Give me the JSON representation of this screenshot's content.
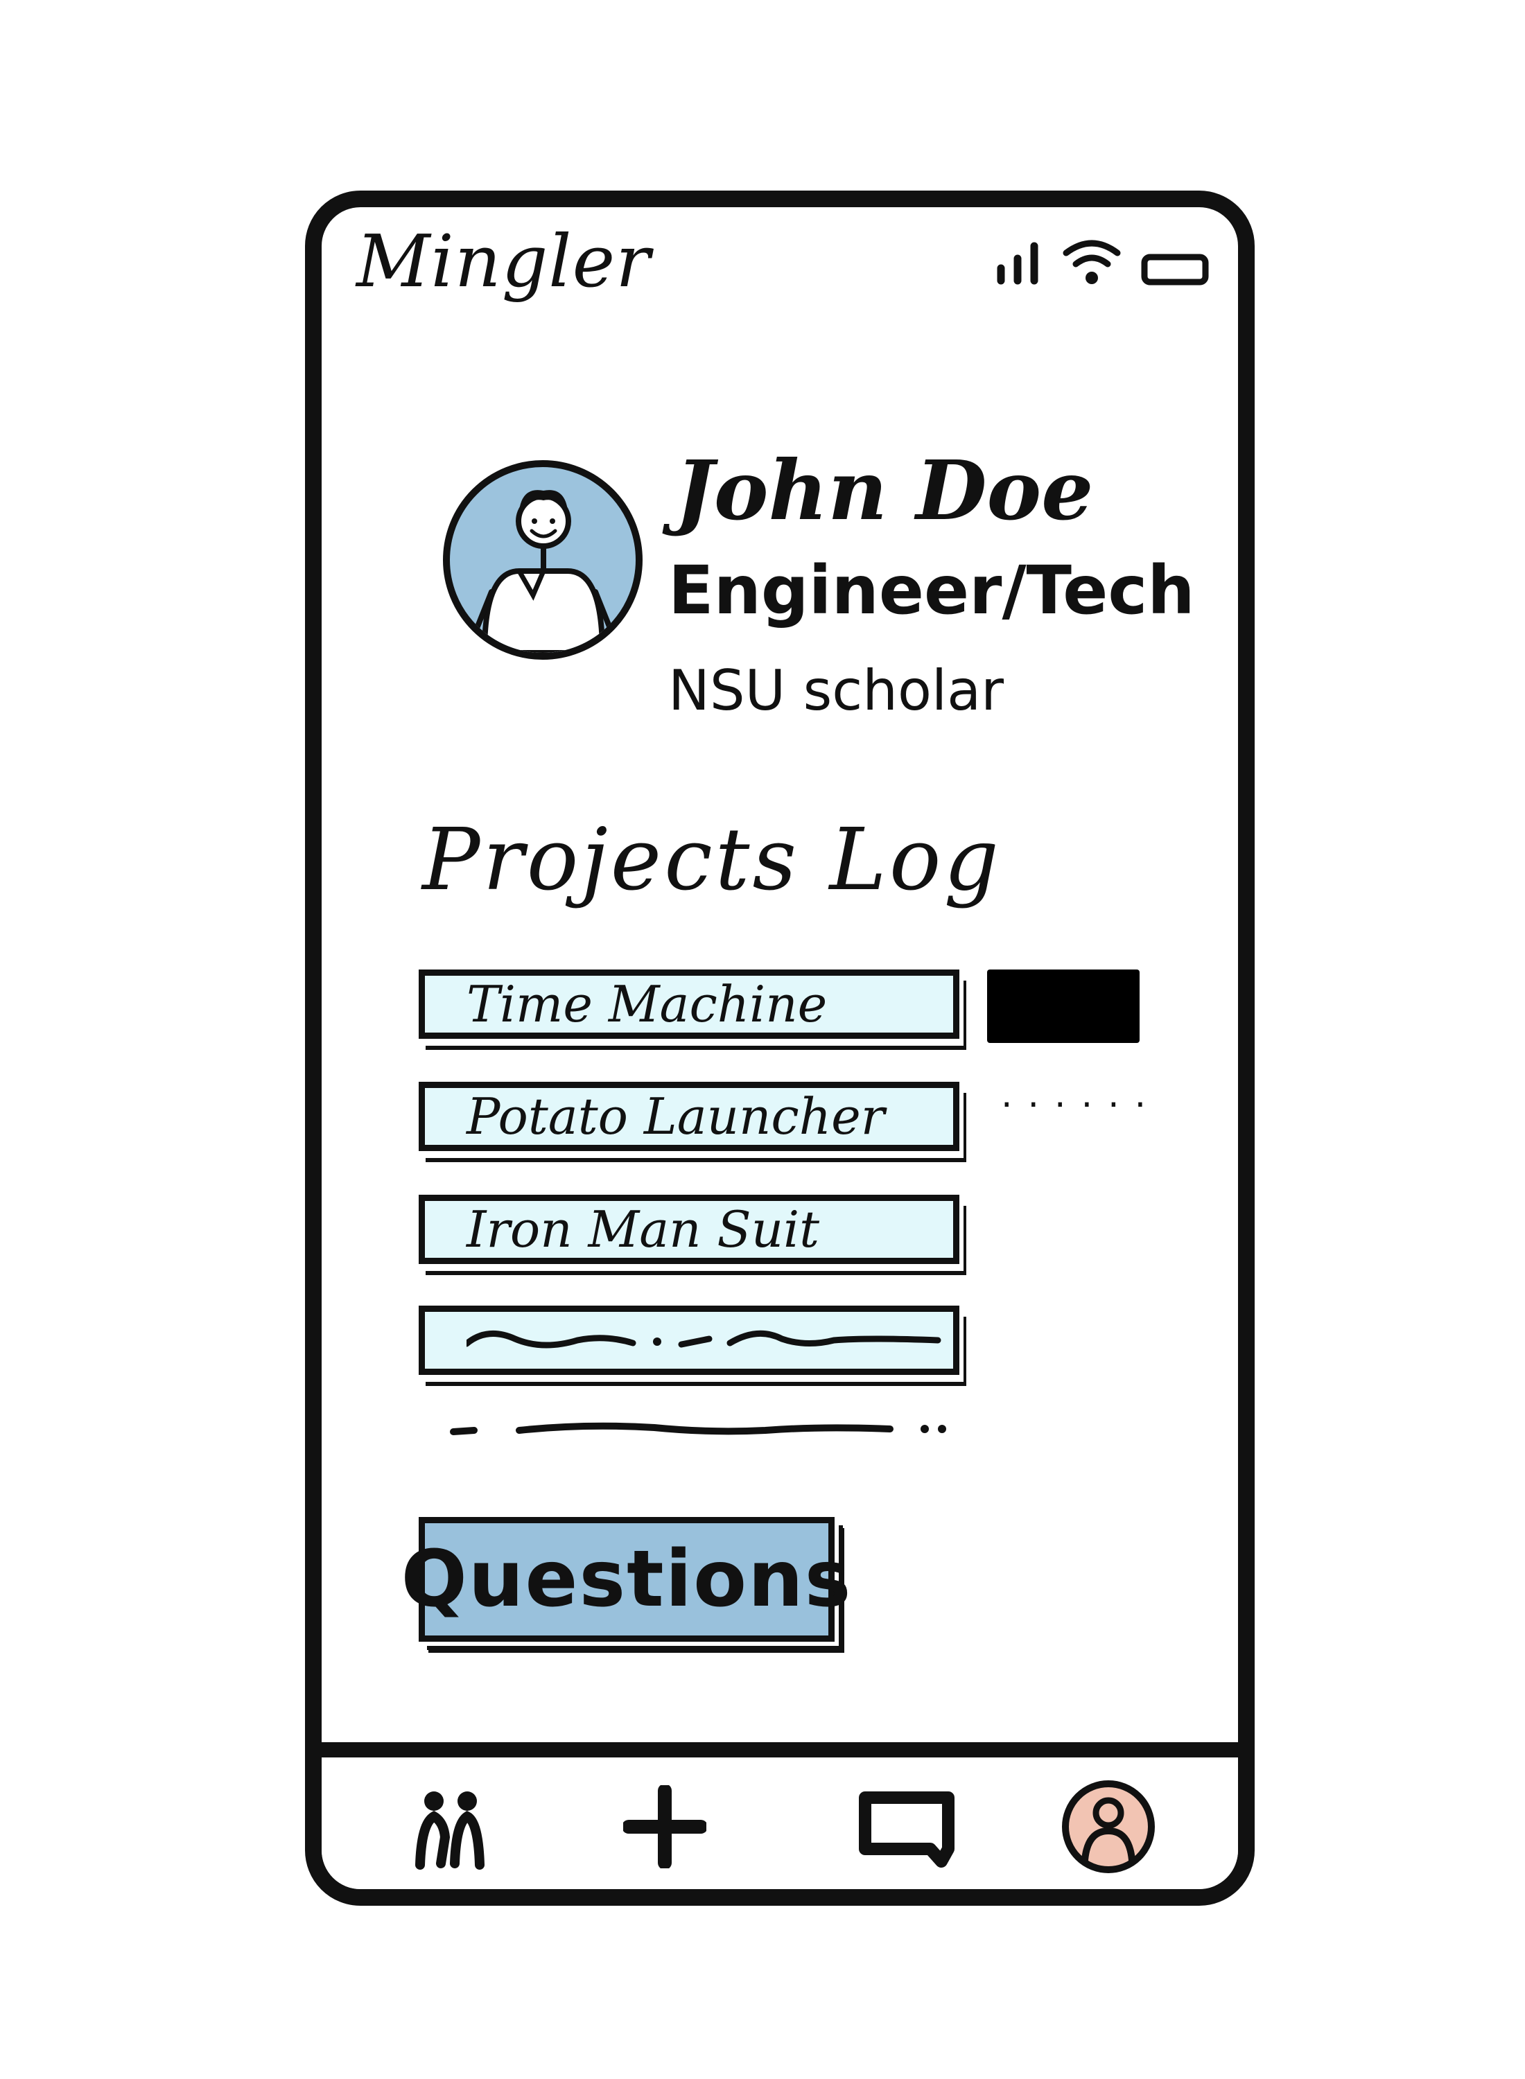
{
  "app": {
    "title": "Mingler"
  },
  "status_bar": {
    "icons": [
      "signal-icon",
      "wifi-icon",
      "battery-icon"
    ]
  },
  "profile": {
    "name": "John Doe",
    "role": "Engineer/Tech",
    "organization": "NSU scholar",
    "avatar_icon": "person-avatar-icon"
  },
  "projects": {
    "title": "Projects Log",
    "items": [
      {
        "label": "Time Machine"
      },
      {
        "label": "Potato Launcher"
      },
      {
        "label": "Iron Man Suit"
      },
      {
        "label": ""
      }
    ]
  },
  "questions_button": {
    "label": "Questions"
  },
  "bottom_nav": {
    "items": [
      {
        "icon": "people-icon"
      },
      {
        "icon": "plus-icon"
      },
      {
        "icon": "chat-icon"
      },
      {
        "icon": "profile-icon"
      }
    ]
  },
  "colors": {
    "avatar_bg": "#9cc3dd",
    "project_item_bg": "#e2f8fb",
    "questions_bg": "#99c1dc",
    "profile_icon_bg": "#f2c4b3",
    "outline": "#111111"
  }
}
